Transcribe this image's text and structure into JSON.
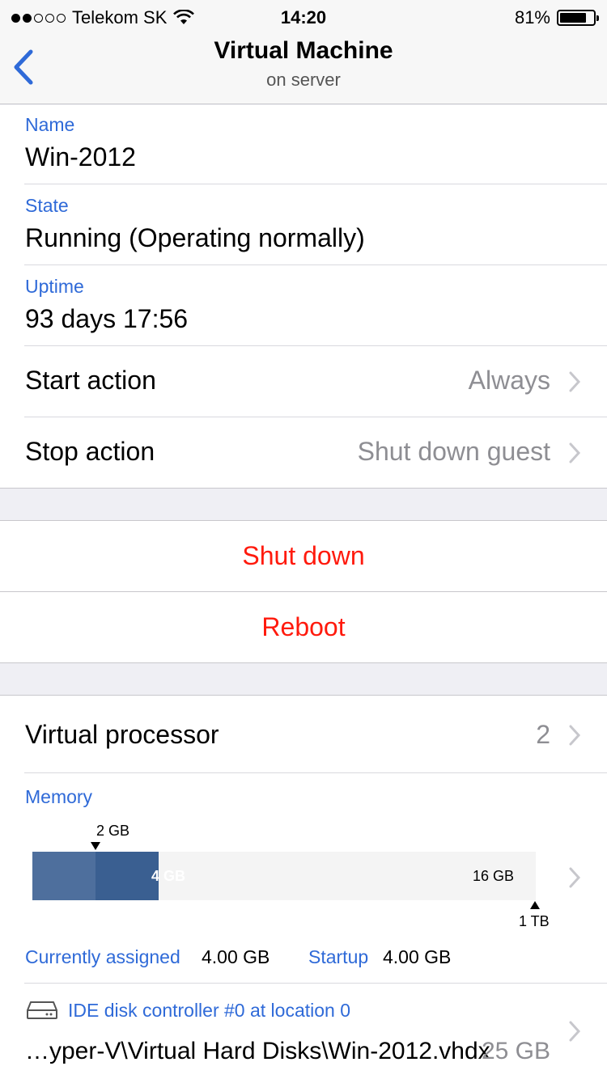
{
  "status_bar": {
    "carrier": "Telekom SK",
    "time": "14:20",
    "battery_percent": "81%",
    "battery_level": 0.81,
    "signal_bars_on": 2,
    "signal_bars_total": 5
  },
  "nav": {
    "title": "Virtual Machine",
    "subtitle": "on server",
    "back_icon": "chevron-left-icon"
  },
  "info": {
    "name_label": "Name",
    "name_value": "Win-2012",
    "state_label": "State",
    "state_value": "Running (Operating normally)",
    "uptime_label": "Uptime",
    "uptime_value": "93 days  17:56"
  },
  "settings": {
    "start_action_label": "Start action",
    "start_action_value": "Always",
    "stop_action_label": "Stop action",
    "stop_action_value": "Shut down guest"
  },
  "actions": {
    "shutdown_label": "Shut down",
    "reboot_label": "Reboot"
  },
  "hardware": {
    "processor_label": "Virtual processor",
    "processor_value": "2",
    "memory_label": "Memory",
    "memory_bar": {
      "min_marker_label": "2 GB",
      "assigned_label": "4 GB",
      "max_label": "16 GB",
      "limit_marker_label": "1 TB",
      "assigned_fraction": 0.25,
      "min_fraction": 0.125
    },
    "currently_assigned_label": "Currently assigned",
    "currently_assigned_value": "4.00 GB",
    "startup_label": "Startup",
    "startup_value": "4.00 GB",
    "disk_controller_label": "IDE disk controller #0 at location 0",
    "disk_path": "…yper-V\\Virtual Hard Disks\\Win-2012.vhdx",
    "disk_size": "25 GB"
  },
  "colors": {
    "accent_blue": "#2f6ad8",
    "destructive_red": "#ff1a0d",
    "memory_min": "#4e6f9d",
    "memory_assigned": "#3a5f91"
  }
}
